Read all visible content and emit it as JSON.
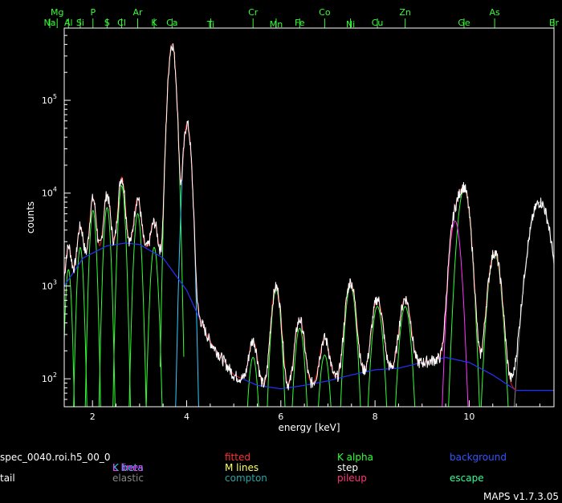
{
  "chart_data": {
    "type": "line",
    "xlabel": "energy [keV]",
    "ylabel": "counts",
    "xlim": [
      1.4,
      11.8
    ],
    "ylim": [
      50,
      600000
    ],
    "yscale": "log",
    "x_ticks": [
      2,
      4,
      6,
      8,
      10
    ],
    "y_ticks": [
      {
        "base": "10",
        "exp": "2",
        "value": 100
      },
      {
        "base": "10",
        "exp": "3",
        "value": 1000
      },
      {
        "base": "10",
        "exp": "4",
        "value": 10000
      },
      {
        "base": "10",
        "exp": "5",
        "value": 100000
      }
    ],
    "element_markers": [
      {
        "label": "Na",
        "x": 1.04,
        "row": 1
      },
      {
        "label": "Mg",
        "x": 1.25,
        "row": 0
      },
      {
        "label": "Al",
        "x": 1.49,
        "row": 1
      },
      {
        "label": "Si",
        "x": 1.74,
        "row": 1
      },
      {
        "label": "P",
        "x": 2.01,
        "row": 0
      },
      {
        "label": "S",
        "x": 2.31,
        "row": 1
      },
      {
        "label": "Cl",
        "x": 2.62,
        "row": 1
      },
      {
        "label": "Ar",
        "x": 2.96,
        "row": 0
      },
      {
        "label": "K",
        "x": 3.31,
        "row": 1
      },
      {
        "label": "Ca",
        "x": 3.69,
        "row": 1
      },
      {
        "label": "Ti",
        "x": 4.51,
        "row": 2
      },
      {
        "label": "Cr",
        "x": 5.41,
        "row": 0
      },
      {
        "label": "Mn",
        "x": 5.9,
        "row": 2
      },
      {
        "label": "Fe",
        "x": 6.4,
        "row": 1
      },
      {
        "label": "Co",
        "x": 6.93,
        "row": 0
      },
      {
        "label": "Ni",
        "x": 7.48,
        "row": 2
      },
      {
        "label": "Cu",
        "x": 8.05,
        "row": 1
      },
      {
        "label": "Zn",
        "x": 8.64,
        "row": 0
      },
      {
        "label": "Ge",
        "x": 9.89,
        "row": 1
      },
      {
        "label": "As",
        "x": 10.54,
        "row": 0
      },
      {
        "label": "Br",
        "x": 11.92,
        "row": 1
      }
    ],
    "peaks": [
      {
        "label": "Na",
        "center": 1.04,
        "amp": 900,
        "sigma": 0.045,
        "family": "K alpha"
      },
      {
        "label": "Mg",
        "center": 1.25,
        "amp": 1100,
        "sigma": 0.045,
        "family": "K alpha"
      },
      {
        "label": "Al",
        "center": 1.49,
        "amp": 1500,
        "sigma": 0.048,
        "family": "K alpha"
      },
      {
        "label": "Si",
        "center": 1.74,
        "amp": 2600,
        "sigma": 0.05,
        "family": "K alpha"
      },
      {
        "label": "P",
        "center": 2.01,
        "amp": 6500,
        "sigma": 0.052,
        "family": "K alpha"
      },
      {
        "label": "S",
        "center": 2.31,
        "amp": 7000,
        "sigma": 0.054,
        "family": "K alpha"
      },
      {
        "label": "Cl",
        "center": 2.62,
        "amp": 12000,
        "sigma": 0.056,
        "family": "K alpha"
      },
      {
        "label": "Ar",
        "center": 2.96,
        "amp": 6000,
        "sigma": 0.058,
        "family": "K alpha"
      },
      {
        "label": "K",
        "center": 3.31,
        "amp": 2600,
        "sigma": 0.06,
        "family": "K alpha"
      },
      {
        "label": "Ca",
        "center": 3.69,
        "amp": 400000,
        "sigma": 0.063,
        "family": "K alpha"
      },
      {
        "label": "Ca beta",
        "center": 4.01,
        "amp": 55000,
        "sigma": 0.065,
        "family": "K beta"
      },
      {
        "label": "Cr",
        "center": 5.41,
        "amp": 170,
        "sigma": 0.075,
        "family": "K alpha"
      },
      {
        "label": "Mn",
        "center": 5.9,
        "amp": 900,
        "sigma": 0.078,
        "family": "K alpha"
      },
      {
        "label": "Fe",
        "center": 6.4,
        "amp": 350,
        "sigma": 0.08,
        "family": "K alpha"
      },
      {
        "label": "Co",
        "center": 6.93,
        "amp": 180,
        "sigma": 0.083,
        "family": "K alpha"
      },
      {
        "label": "Ni",
        "center": 7.48,
        "amp": 1000,
        "sigma": 0.086,
        "family": "K alpha"
      },
      {
        "label": "Cu",
        "center": 8.05,
        "amp": 600,
        "sigma": 0.089,
        "family": "K alpha"
      },
      {
        "label": "Zn",
        "center": 8.64,
        "amp": 600,
        "sigma": 0.092,
        "family": "K alpha"
      },
      {
        "label": "Ge",
        "center": 9.89,
        "amp": 11000,
        "sigma": 0.1,
        "family": "K alpha"
      },
      {
        "label": "L lines",
        "center": 9.7,
        "amp": 5000,
        "sigma": 0.09,
        "family": "L lines"
      },
      {
        "label": "As",
        "center": 10.54,
        "amp": 2200,
        "sigma": 0.104,
        "family": "K alpha"
      },
      {
        "label": "elastic",
        "center": 11.5,
        "amp": 8000,
        "sigma": 0.17,
        "family": "elastic"
      }
    ],
    "background_points": [
      [
        1.4,
        1000
      ],
      [
        1.8,
        2000
      ],
      [
        2.3,
        2700
      ],
      [
        2.7,
        2900
      ],
      [
        3.0,
        2800
      ],
      [
        3.5,
        2000
      ],
      [
        4.0,
        900
      ],
      [
        4.5,
        250
      ],
      [
        5.0,
        110
      ],
      [
        5.5,
        85
      ],
      [
        6.0,
        78
      ],
      [
        6.5,
        85
      ],
      [
        7.0,
        95
      ],
      [
        7.5,
        110
      ],
      [
        8.0,
        125
      ],
      [
        8.5,
        130
      ],
      [
        9.0,
        150
      ],
      [
        9.5,
        170
      ],
      [
        10.0,
        150
      ],
      [
        10.5,
        110
      ],
      [
        11.0,
        75
      ],
      [
        11.8,
        75
      ]
    ],
    "legend": [
      {
        "label": "spec_0040.roi.h5_00_0",
        "color": "#ffffff"
      },
      {
        "label": "fitted",
        "color": "#ff3333"
      },
      {
        "label": "K alpha",
        "color": "#33ff33"
      },
      {
        "label": "background",
        "color": "#3355ff"
      },
      {
        "label": "K beta",
        "color": "#33ccff"
      },
      {
        "label": "L lines",
        "color": "#ff33ff"
      },
      {
        "label": "M lines",
        "color": "#ffff66"
      },
      {
        "label": "step",
        "color": "#ffffff"
      },
      {
        "label": "tail",
        "color": "#ffffff"
      },
      {
        "label": "elastic",
        "color": "#888888"
      },
      {
        "label": "compton",
        "color": "#2aa6a6"
      },
      {
        "label": "pileup",
        "color": "#ff3377"
      },
      {
        "label": "escape",
        "color": "#33ff99"
      }
    ]
  },
  "footer": {
    "version": "MAPS v1.7.3.05"
  },
  "colors": {
    "spectrum": "#ffffff",
    "fitted": "#cc1111",
    "k_alpha": "#33ff33",
    "background": "#2233ff",
    "k_beta": "#33ccff",
    "l_lines": "#ff33ff",
    "elastic": "#888888",
    "axis": "#ffffff"
  }
}
